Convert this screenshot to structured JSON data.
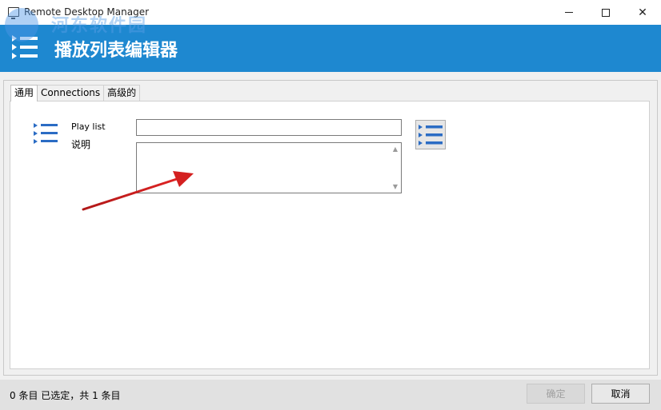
{
  "window": {
    "title": "Remote Desktop Manager",
    "minimize_glyph": "",
    "close_glyph": "✕"
  },
  "watermark": {
    "text": "河东软件园"
  },
  "header": {
    "title": "播放列表编辑器",
    "icon": "playlist-icon",
    "color": "#1e88d0"
  },
  "tabs": [
    {
      "label": "通用",
      "active": true
    },
    {
      "label": "Connections",
      "active": false
    },
    {
      "label": "高级的",
      "active": false
    }
  ],
  "form": {
    "playlist_label": "Play list",
    "playlist_value": "",
    "description_label": "说明",
    "description_value": ""
  },
  "status": {
    "text": "0 条目 已选定，共 1 条目"
  },
  "buttons": {
    "ok_label": "确定",
    "cancel_label": "取消"
  },
  "colors": {
    "accent": "#1e88d0",
    "icon_blue": "#2b6cc4",
    "arrow_red": "#d42020"
  }
}
